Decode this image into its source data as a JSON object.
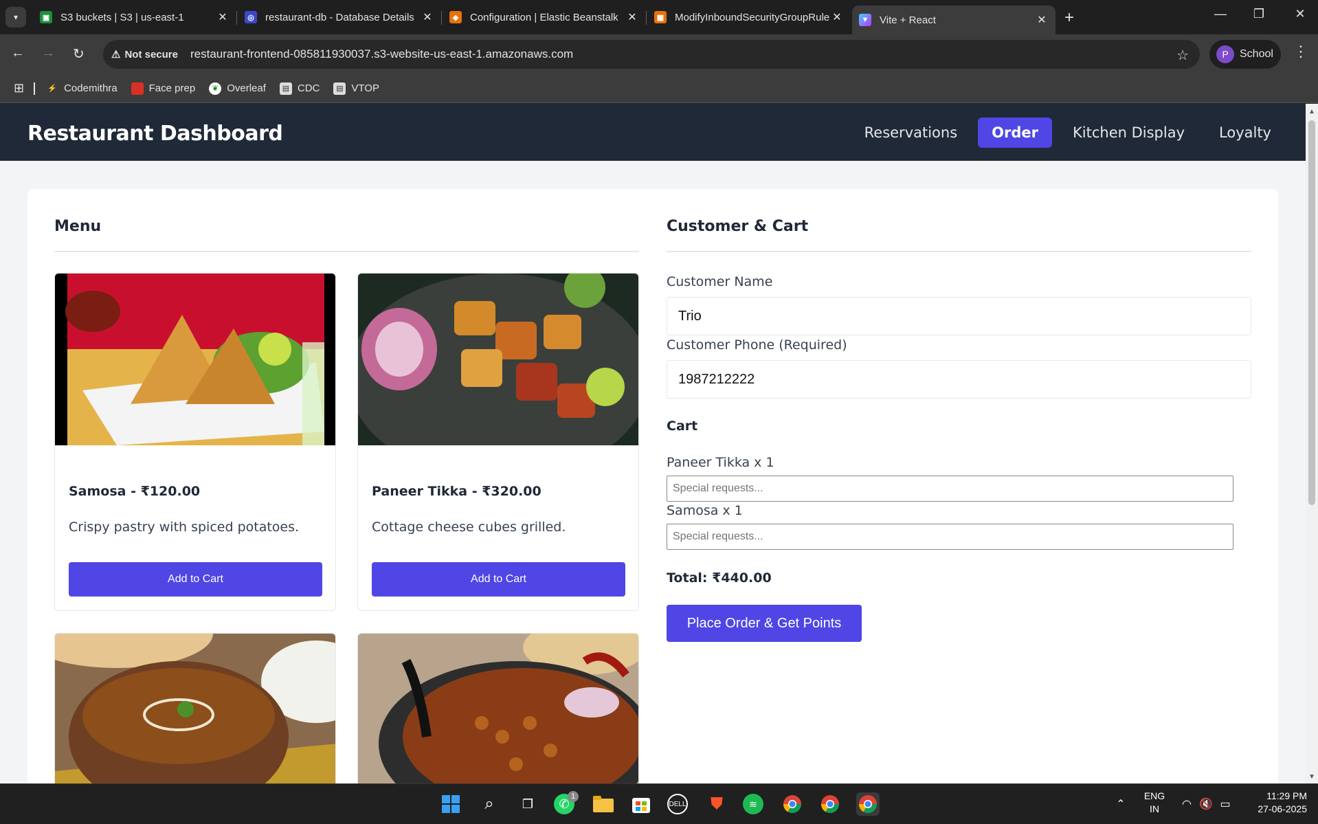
{
  "browser": {
    "tabs": [
      {
        "title": "S3 buckets | S3 | us-east-1",
        "fav_color": "#1e8e3e",
        "icon": "s3-icon"
      },
      {
        "title": "restaurant-db - Database Details",
        "fav_color": "#3b48cc",
        "icon": "rds-icon"
      },
      {
        "title": "Configuration | Elastic Beanstalk",
        "fav_color": "#e8710a",
        "icon": "beanstalk-icon"
      },
      {
        "title": "ModifyInboundSecurityGroupRules",
        "fav_color": "#e8710a",
        "icon": "ec2-icon"
      },
      {
        "title": "Vite + React",
        "fav_color": "#a855f7",
        "icon": "vite-icon"
      }
    ],
    "not_secure": "Not secure",
    "url": "restaurant-frontend-085811930037.s3-website-us-east-1.amazonaws.com",
    "profile_initial": "P",
    "profile_name": "School",
    "bookmarks": [
      {
        "label": "Codemithra",
        "color": "#f4b400"
      },
      {
        "label": "Face prep",
        "color": "#d93025"
      },
      {
        "label": "Overleaf",
        "color": "#ffffff"
      },
      {
        "label": "CDC",
        "color": "#8ab4f8"
      },
      {
        "label": "VTOP",
        "color": "#8ab4f8"
      }
    ]
  },
  "app": {
    "brand": "Restaurant Dashboard",
    "nav": [
      "Reservations",
      "Order",
      "Kitchen Display",
      "Loyalty"
    ],
    "active_nav": "Order",
    "accent": "#4f46e5"
  },
  "menu": {
    "heading": "Menu",
    "items": [
      {
        "name": "Samosa - ₹120.00",
        "desc": "Crispy pastry with spiced potatoes.",
        "button": "Add to Cart"
      },
      {
        "name": "Paneer Tikka - ₹320.00",
        "desc": "Cottage cheese cubes grilled.",
        "button": "Add to Cart"
      },
      {
        "name": "",
        "desc": "",
        "button": ""
      },
      {
        "name": "",
        "desc": "",
        "button": ""
      }
    ]
  },
  "customer": {
    "heading": "Customer & Cart",
    "name_label": "Customer Name",
    "name_value": "Trio",
    "phone_label": "Customer Phone (Required)",
    "phone_value": "1987212222",
    "cart_heading": "Cart",
    "cart": [
      {
        "line": "Paneer Tikka x 1",
        "placeholder": "Special requests..."
      },
      {
        "line": "Samosa x 1",
        "placeholder": "Special requests..."
      }
    ],
    "total": "Total: ₹440.00",
    "place_button": "Place Order & Get Points"
  },
  "taskbar": {
    "lang_top": "ENG",
    "lang_bottom": "IN",
    "time": "11:29 PM",
    "date": "27-06-2025",
    "whatsapp_badge": "1"
  }
}
